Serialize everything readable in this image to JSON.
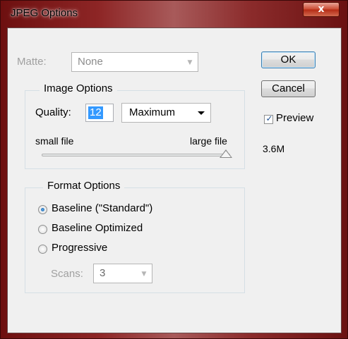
{
  "window": {
    "title": "JPEG Options",
    "close_label": "x"
  },
  "matte": {
    "label": "Matte:",
    "value": "None",
    "enabled": false
  },
  "image_options": {
    "title": "Image Options",
    "quality_label": "Quality:",
    "quality_value": "12",
    "quality_preset": "Maximum",
    "small_label": "small file",
    "large_label": "large file",
    "slider_fraction": 1.0
  },
  "format_options": {
    "title": "Format Options",
    "options": [
      {
        "label": "Baseline (\"Standard\")",
        "checked": true
      },
      {
        "label": "Baseline Optimized",
        "checked": false
      },
      {
        "label": "Progressive",
        "checked": false
      }
    ],
    "scans_label": "Scans:",
    "scans_value": "3"
  },
  "buttons": {
    "ok": "OK",
    "cancel": "Cancel"
  },
  "preview": {
    "label": "Preview",
    "checked": true,
    "size": "3.6M"
  }
}
